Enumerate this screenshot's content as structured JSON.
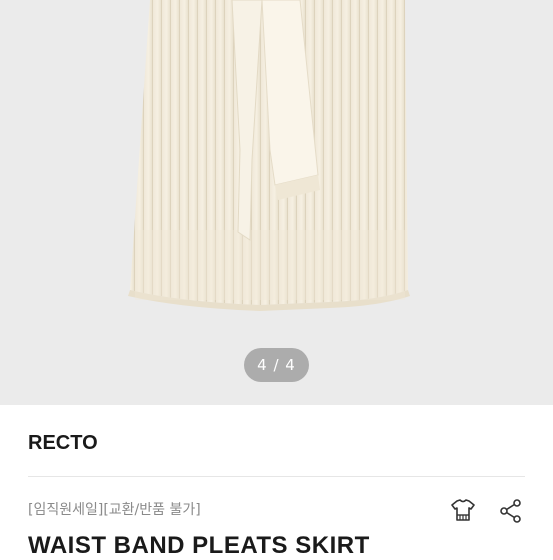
{
  "gallery": {
    "pager_text": "4 / 4"
  },
  "product": {
    "brand": "RECTO",
    "subtitle": "[임직원세일][교환/반품 불가]",
    "title": "WAIST BAND PLEATS SKIRT"
  },
  "icons": {
    "size_guide": "tshirt-icon",
    "share": "share-icon"
  }
}
